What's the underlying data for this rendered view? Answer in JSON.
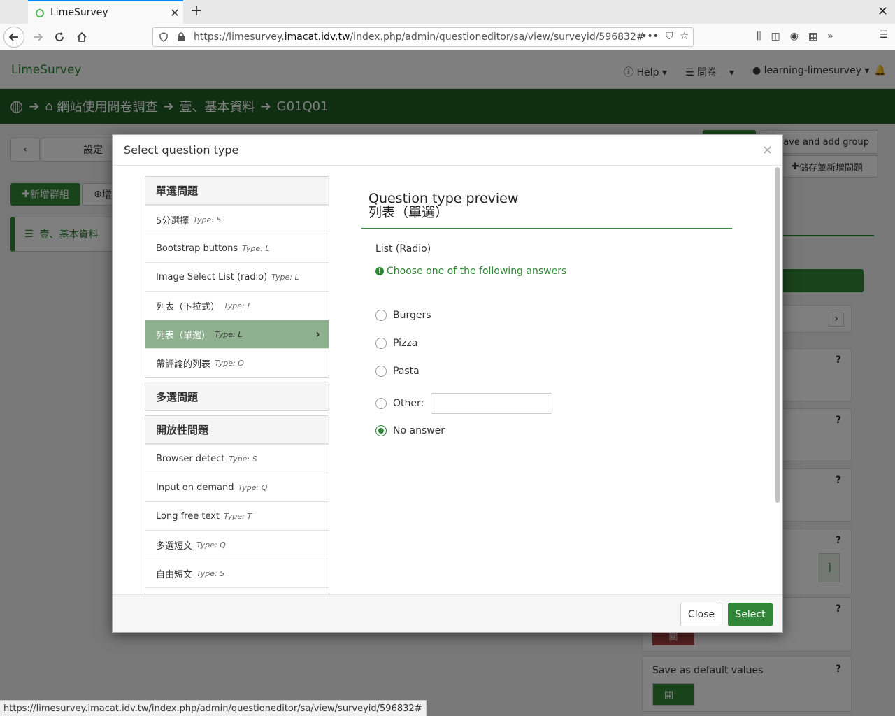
{
  "browser": {
    "tab_title": "LimeSurvey",
    "url_prefix": "https://limesurvey.",
    "url_domain": "imacat.idv.tw",
    "url_suffix": "/index.php/admin/questioneditor/sa/view/surveyid/596832#",
    "status_url": "https://limesurvey.imacat.idv.tw/index.php/admin/questioneditor/sa/view/surveyid/596832#"
  },
  "app": {
    "brand": "LimeSurvey",
    "help": "Help",
    "surveys": "問卷",
    "user": "learning-limesurvey",
    "breadcrumb": [
      "網站使用問卷調查",
      "壹、基本資料",
      "G01Q01"
    ],
    "settings": "設定",
    "add_group": "新增群組",
    "add_question_short": "增",
    "group_item": "壹、基本資料",
    "save_add_group": "Save and add group",
    "save_add_question": "儲存並新增問題",
    "save_default": "Save as default values",
    "toggle_on": "開",
    "toggle_off": "關",
    "toggle_partial": "]"
  },
  "modal": {
    "title": "Select question type",
    "close_label": "Close",
    "select_label": "Select",
    "groups": [
      {
        "name": "單選問題",
        "items": [
          {
            "label": "5分選擇",
            "type": "Type: 5"
          },
          {
            "label": "Bootstrap buttons",
            "type": "Type: L"
          },
          {
            "label": "Image Select List (radio)",
            "type": "Type: L"
          },
          {
            "label": "列表（下拉式）",
            "type": "Type: !"
          },
          {
            "label": "列表（單選）",
            "type": "Type: L"
          },
          {
            "label": "帶評論的列表",
            "type": "Type: O"
          }
        ]
      },
      {
        "name": "多選問題",
        "items": []
      },
      {
        "name": "開放性問題",
        "items": [
          {
            "label": "Browser detect",
            "type": "Type: S"
          },
          {
            "label": "Input on demand",
            "type": "Type: Q"
          },
          {
            "label": "Long free text",
            "type": "Type: T"
          },
          {
            "label": "多選短文",
            "type": "Type: Q"
          },
          {
            "label": "自由短文",
            "type": "Type: S"
          }
        ]
      }
    ],
    "preview": {
      "heading": "Question type preview",
      "type_name": "列表（單選）",
      "question": "List (Radio)",
      "tip": "Choose one of the following answers",
      "options": [
        "Burgers",
        "Pizza",
        "Pasta"
      ],
      "other_label": "Other:",
      "no_answer": "No answer"
    }
  }
}
